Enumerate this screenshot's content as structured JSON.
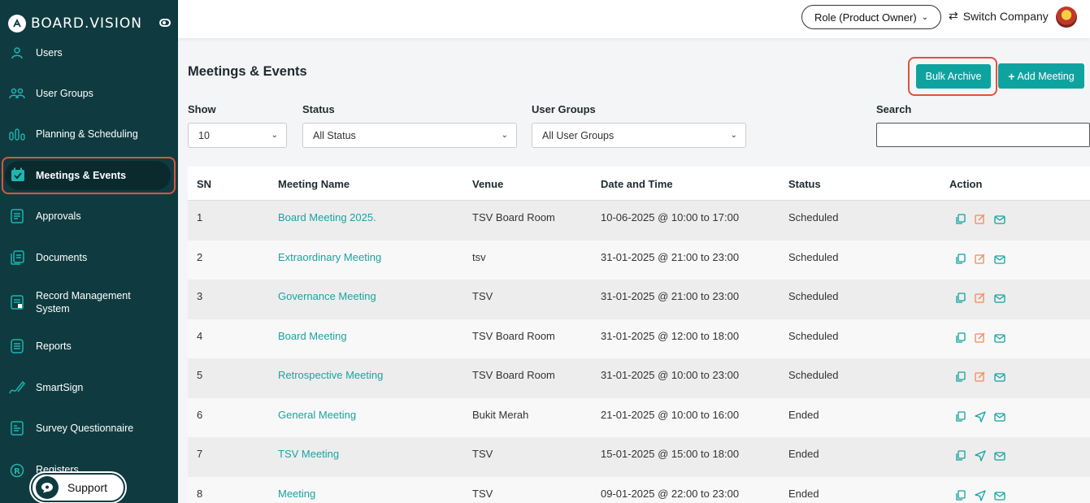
{
  "brand": {
    "name": "BOARD.VISION"
  },
  "sidebar": {
    "items": [
      {
        "label": "Users",
        "icon": "user-icon"
      },
      {
        "label": "User Groups",
        "icon": "user-group-icon"
      },
      {
        "label": "Planning & Scheduling",
        "icon": "planning-icon"
      },
      {
        "label": "Meetings & Events",
        "icon": "calendar-check-icon",
        "active": true
      },
      {
        "label": "Approvals",
        "icon": "approvals-icon"
      },
      {
        "label": "Documents",
        "icon": "documents-icon"
      },
      {
        "label": "Record Management System",
        "icon": "record-icon"
      },
      {
        "label": "Reports",
        "icon": "reports-icon"
      },
      {
        "label": "SmartSign",
        "icon": "signature-icon"
      },
      {
        "label": "Survey Questionnaire",
        "icon": "survey-icon"
      },
      {
        "label": "Registers",
        "icon": "registers-icon"
      }
    ],
    "support_label": "Support"
  },
  "topbar": {
    "role_label": "Role (Product Owner)",
    "switch_label": "Switch Company"
  },
  "main": {
    "title": "Meetings & Events",
    "bulk_archive_label": "Bulk Archive",
    "add_meeting_label": "Add Meeting",
    "filters": {
      "show_label": "Show",
      "show_value": "10",
      "status_label": "Status",
      "status_value": "All Status",
      "groups_label": "User Groups",
      "groups_value": "All User Groups",
      "search_label": "Search",
      "search_value": ""
    },
    "table": {
      "headers": [
        "SN",
        "Meeting Name",
        "Venue",
        "Date and Time",
        "Status",
        "Action"
      ],
      "rows": [
        {
          "sn": "1",
          "name": "Board Meeting 2025.",
          "venue": "TSV Board Room",
          "datetime": "10-06-2025 @ 10:00 to 17:00",
          "status": "Scheduled",
          "actions": [
            "copy-icon",
            "edit-icon",
            "mail-icon"
          ]
        },
        {
          "sn": "2",
          "name": "Extraordinary Meeting",
          "venue": "tsv",
          "datetime": "31-01-2025 @ 21:00 to 23:00",
          "status": "Scheduled",
          "actions": [
            "copy-icon",
            "edit-icon",
            "mail-icon"
          ]
        },
        {
          "sn": "3",
          "name": "Governance Meeting",
          "venue": "TSV",
          "datetime": "31-01-2025 @ 21:00 to 23:00",
          "status": "Scheduled",
          "actions": [
            "copy-icon",
            "edit-icon",
            "mail-icon"
          ]
        },
        {
          "sn": "4",
          "name": "Board Meeting",
          "venue": "TSV Board Room",
          "datetime": "31-01-2025 @ 12:00 to 18:00",
          "status": "Scheduled",
          "actions": [
            "copy-icon",
            "edit-icon",
            "mail-icon"
          ]
        },
        {
          "sn": "5",
          "name": "Retrospective Meeting",
          "venue": "TSV Board Room",
          "datetime": "31-01-2025 @ 10:00 to 23:00",
          "status": "Scheduled",
          "actions": [
            "copy-icon",
            "edit-icon",
            "mail-icon"
          ]
        },
        {
          "sn": "6",
          "name": "General Meeting",
          "venue": "Bukit Merah",
          "datetime": "21-01-2025 @ 10:00 to 16:00",
          "status": "Ended",
          "actions": [
            "copy-icon",
            "send-icon",
            "mail-icon"
          ]
        },
        {
          "sn": "7",
          "name": "TSV Meeting",
          "venue": "TSV",
          "datetime": "15-01-2025 @ 15:00 to 18:00",
          "status": "Ended",
          "actions": [
            "copy-icon",
            "send-icon",
            "mail-icon"
          ]
        },
        {
          "sn": "8",
          "name": "Meeting",
          "venue": "TSV",
          "datetime": "09-01-2025 @ 22:00 to 23:00",
          "status": "Ended",
          "actions": [
            "copy-icon",
            "send-icon",
            "mail-icon"
          ]
        }
      ]
    }
  },
  "colors": {
    "sidebar_bg": "#0f3b40",
    "accent_teal": "#0fa3a0",
    "highlight_red": "#e0533b",
    "edit_orange": "#f08a5d"
  }
}
